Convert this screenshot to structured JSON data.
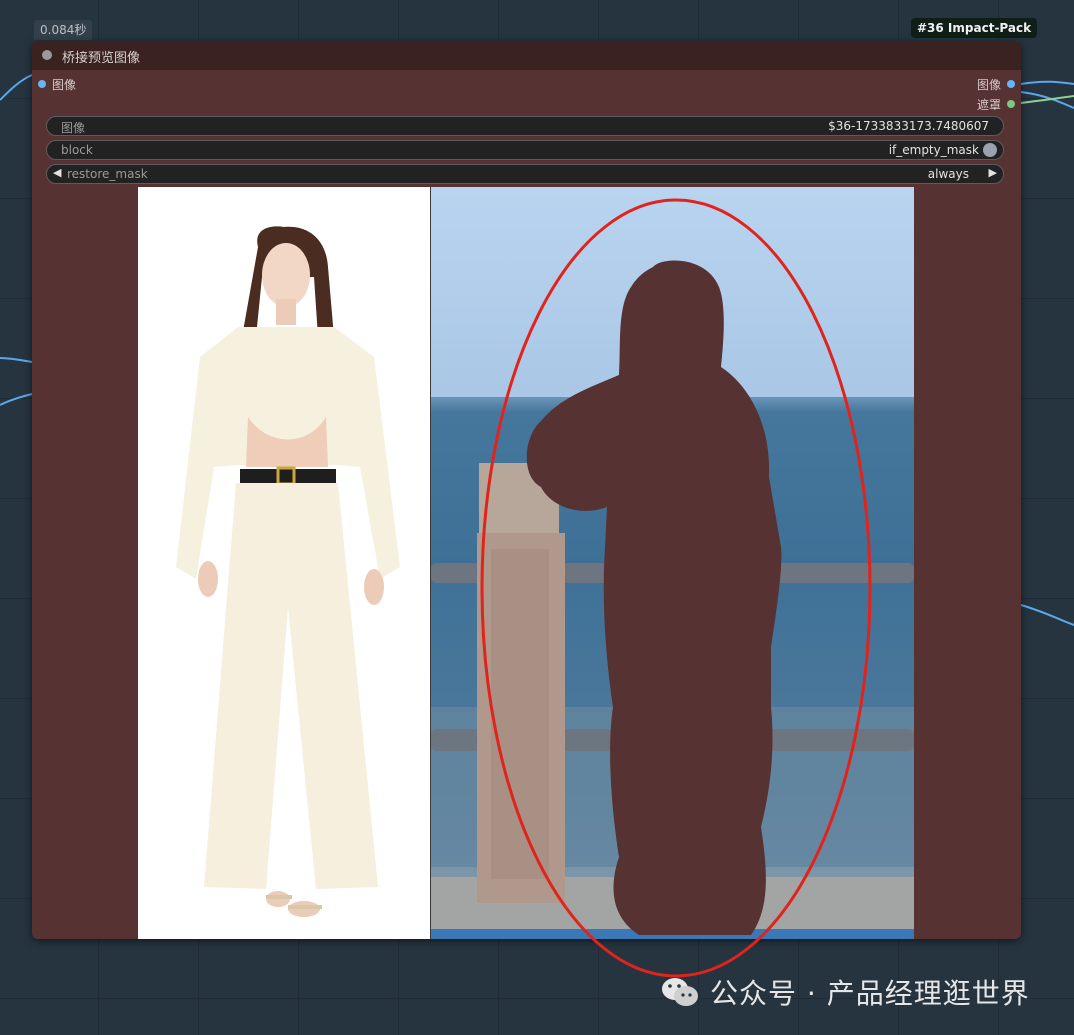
{
  "canvas": {
    "timing_label": "0.084秒",
    "badge_label": "#36 Impact-Pack"
  },
  "node": {
    "title": "桥接预览图像",
    "inputs": [
      {
        "label": "图像",
        "color": "#64b5f6"
      }
    ],
    "outputs": [
      {
        "label": "图像",
        "color": "#64b5f6"
      },
      {
        "label": "遮罩",
        "color": "#81c784"
      }
    ],
    "widgets": {
      "image": {
        "label": "图像",
        "value": "$36-1733833173.7480607"
      },
      "block": {
        "label": "block",
        "value": "if_empty_mask"
      },
      "restore_mask": {
        "label": "restore_mask",
        "value": "always"
      }
    },
    "preview": {
      "left_image": "woman-in-cream-outfit-photo",
      "right_image": "seaside-railing-with-masked-figure",
      "mask_color": "#563232",
      "annotation_color": "#e0241c"
    }
  },
  "watermark": {
    "text": "公众号 · 产品经理逛世界",
    "icon": "wechat-icon"
  },
  "colors": {
    "node_body": "#563232",
    "node_header": "#3a2221",
    "canvas_bg": "#263440"
  }
}
